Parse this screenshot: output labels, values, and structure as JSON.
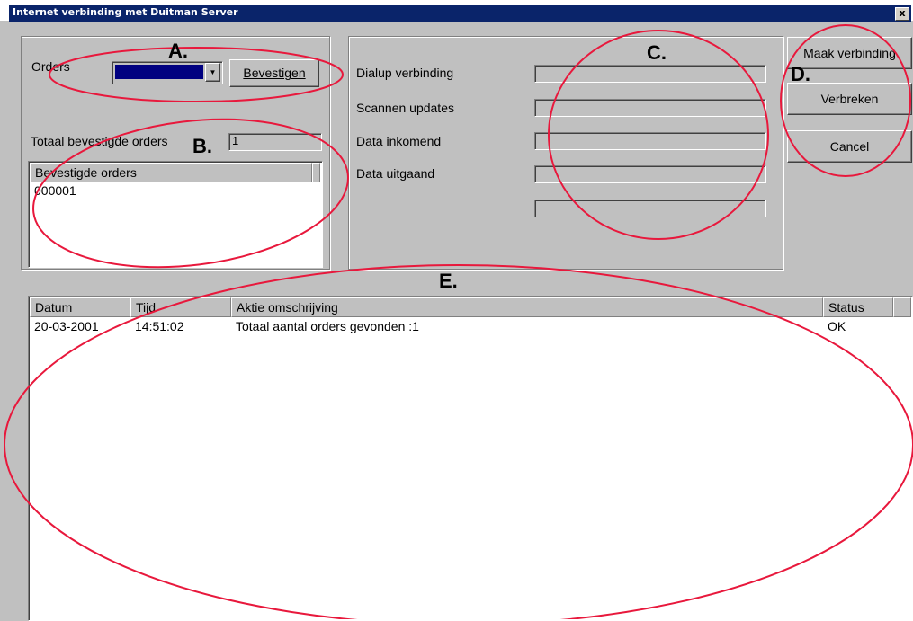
{
  "window": {
    "title": "Internet verbinding met Duitman Server",
    "close_label": "x"
  },
  "orders": {
    "label": "Orders",
    "select_value": "",
    "confirm_button": "Bevestigen",
    "total_label": "Totaal bevestigde orders",
    "total_value": "1",
    "list_header": "Bevestigde orders",
    "list_items": [
      "000001"
    ]
  },
  "status_panel": {
    "rows": [
      "Dialup verbinding",
      "Scannen updates",
      "Data inkomend",
      "Data uitgaand",
      ""
    ]
  },
  "buttons": {
    "connect": "Maak verbinding",
    "disconnect": "Verbreken",
    "cancel": "Cancel"
  },
  "log": {
    "columns": [
      "Datum",
      "Tijd",
      "Aktie omschrijving",
      "Status"
    ],
    "rows": [
      [
        "20-03-2001",
        "14:51:02",
        "Totaal aantal orders gevonden :1",
        "OK"
      ]
    ]
  },
  "annotations": {
    "labels": [
      "A.",
      "B.",
      "C.",
      "D.",
      "E."
    ],
    "color": "#e8183c"
  },
  "colors": {
    "select_fill": "#000080",
    "titlebar": "#0a246a"
  }
}
